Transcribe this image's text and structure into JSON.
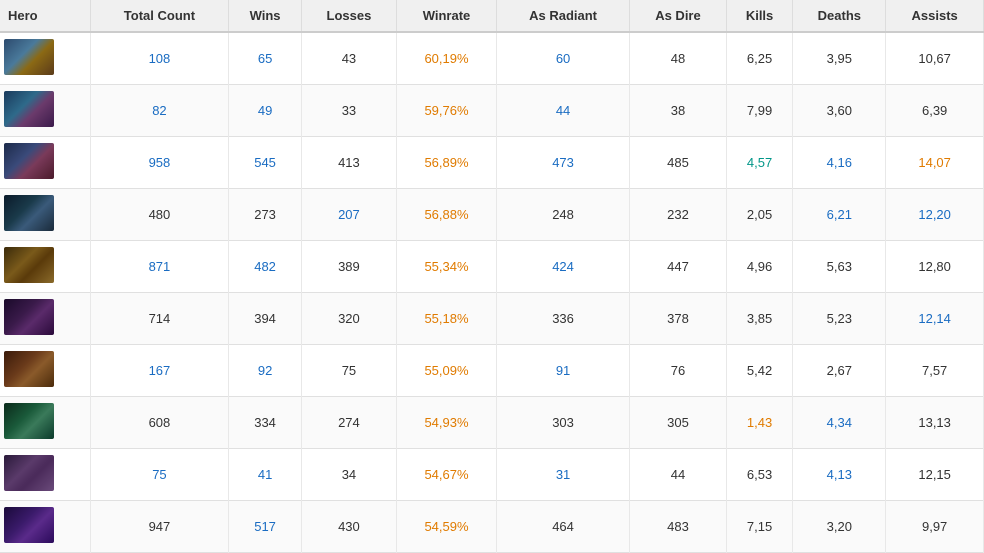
{
  "table": {
    "headers": [
      {
        "key": "hero",
        "label": "Hero"
      },
      {
        "key": "total_count",
        "label": "Total Count"
      },
      {
        "key": "wins",
        "label": "Wins"
      },
      {
        "key": "losses",
        "label": "Losses"
      },
      {
        "key": "winrate",
        "label": "Winrate"
      },
      {
        "key": "as_radiant",
        "label": "As Radiant"
      },
      {
        "key": "as_dire",
        "label": "As Dire"
      },
      {
        "key": "kills",
        "label": "Kills"
      },
      {
        "key": "deaths",
        "label": "Deaths"
      },
      {
        "key": "assists",
        "label": "Assists"
      }
    ],
    "rows": [
      {
        "hero_class": "hero-1",
        "total_count": "108",
        "wins": "65",
        "losses": "43",
        "winrate": "60,19%",
        "as_radiant": "60",
        "as_dire": "48",
        "kills": "6,25",
        "deaths": "3,95",
        "assists": "10,67",
        "total_color": "blue",
        "wins_color": "blue",
        "losses_color": "default",
        "winrate_color": "orange",
        "radiant_color": "blue",
        "dire_color": "default",
        "kills_color": "default",
        "deaths_color": "default",
        "assists_color": "default"
      },
      {
        "hero_class": "hero-2",
        "total_count": "82",
        "wins": "49",
        "losses": "33",
        "winrate": "59,76%",
        "as_radiant": "44",
        "as_dire": "38",
        "kills": "7,99",
        "deaths": "3,60",
        "assists": "6,39",
        "total_color": "blue",
        "wins_color": "blue",
        "losses_color": "default",
        "winrate_color": "orange",
        "radiant_color": "blue",
        "dire_color": "default",
        "kills_color": "default",
        "deaths_color": "default",
        "assists_color": "default"
      },
      {
        "hero_class": "hero-3",
        "total_count": "958",
        "wins": "545",
        "losses": "413",
        "winrate": "56,89%",
        "as_radiant": "473",
        "as_dire": "485",
        "kills": "4,57",
        "deaths": "4,16",
        "assists": "14,07",
        "total_color": "blue",
        "wins_color": "blue",
        "losses_color": "default",
        "winrate_color": "orange",
        "radiant_color": "blue",
        "dire_color": "default",
        "kills_color": "teal",
        "deaths_color": "blue",
        "assists_color": "orange"
      },
      {
        "hero_class": "hero-4",
        "total_count": "480",
        "wins": "273",
        "losses": "207",
        "winrate": "56,88%",
        "as_radiant": "248",
        "as_dire": "232",
        "kills": "2,05",
        "deaths": "6,21",
        "assists": "12,20",
        "total_color": "default",
        "wins_color": "default",
        "losses_color": "blue",
        "winrate_color": "orange",
        "radiant_color": "default",
        "dire_color": "default",
        "kills_color": "default",
        "deaths_color": "blue",
        "assists_color": "blue"
      },
      {
        "hero_class": "hero-5",
        "total_count": "871",
        "wins": "482",
        "losses": "389",
        "winrate": "55,34%",
        "as_radiant": "424",
        "as_dire": "447",
        "kills": "4,96",
        "deaths": "5,63",
        "assists": "12,80",
        "total_color": "blue",
        "wins_color": "blue",
        "losses_color": "default",
        "winrate_color": "orange",
        "radiant_color": "blue",
        "dire_color": "default",
        "kills_color": "default",
        "deaths_color": "default",
        "assists_color": "default"
      },
      {
        "hero_class": "hero-6",
        "total_count": "714",
        "wins": "394",
        "losses": "320",
        "winrate": "55,18%",
        "as_radiant": "336",
        "as_dire": "378",
        "kills": "3,85",
        "deaths": "5,23",
        "assists": "12,14",
        "total_color": "default",
        "wins_color": "default",
        "losses_color": "default",
        "winrate_color": "orange",
        "radiant_color": "default",
        "dire_color": "default",
        "kills_color": "default",
        "deaths_color": "default",
        "assists_color": "blue"
      },
      {
        "hero_class": "hero-7",
        "total_count": "167",
        "wins": "92",
        "losses": "75",
        "winrate": "55,09%",
        "as_radiant": "91",
        "as_dire": "76",
        "kills": "5,42",
        "deaths": "2,67",
        "assists": "7,57",
        "total_color": "blue",
        "wins_color": "blue",
        "losses_color": "default",
        "winrate_color": "orange",
        "radiant_color": "blue",
        "dire_color": "default",
        "kills_color": "default",
        "deaths_color": "default",
        "assists_color": "default"
      },
      {
        "hero_class": "hero-8",
        "total_count": "608",
        "wins": "334",
        "losses": "274",
        "winrate": "54,93%",
        "as_radiant": "303",
        "as_dire": "305",
        "kills": "1,43",
        "deaths": "4,34",
        "assists": "13,13",
        "total_color": "default",
        "wins_color": "default",
        "losses_color": "default",
        "winrate_color": "orange",
        "radiant_color": "default",
        "dire_color": "default",
        "kills_color": "orange",
        "deaths_color": "blue",
        "assists_color": "default"
      },
      {
        "hero_class": "hero-9",
        "total_count": "75",
        "wins": "41",
        "losses": "34",
        "winrate": "54,67%",
        "as_radiant": "31",
        "as_dire": "44",
        "kills": "6,53",
        "deaths": "4,13",
        "assists": "12,15",
        "total_color": "blue",
        "wins_color": "blue",
        "losses_color": "default",
        "winrate_color": "orange",
        "radiant_color": "blue",
        "dire_color": "default",
        "kills_color": "default",
        "deaths_color": "blue",
        "assists_color": "default"
      },
      {
        "hero_class": "hero-10",
        "total_count": "947",
        "wins": "517",
        "losses": "430",
        "winrate": "54,59%",
        "as_radiant": "464",
        "as_dire": "483",
        "kills": "7,15",
        "deaths": "3,20",
        "assists": "9,97",
        "total_color": "default",
        "wins_color": "blue",
        "losses_color": "default",
        "winrate_color": "orange",
        "radiant_color": "default",
        "dire_color": "default",
        "kills_color": "default",
        "deaths_color": "default",
        "assists_color": "default"
      }
    ]
  }
}
